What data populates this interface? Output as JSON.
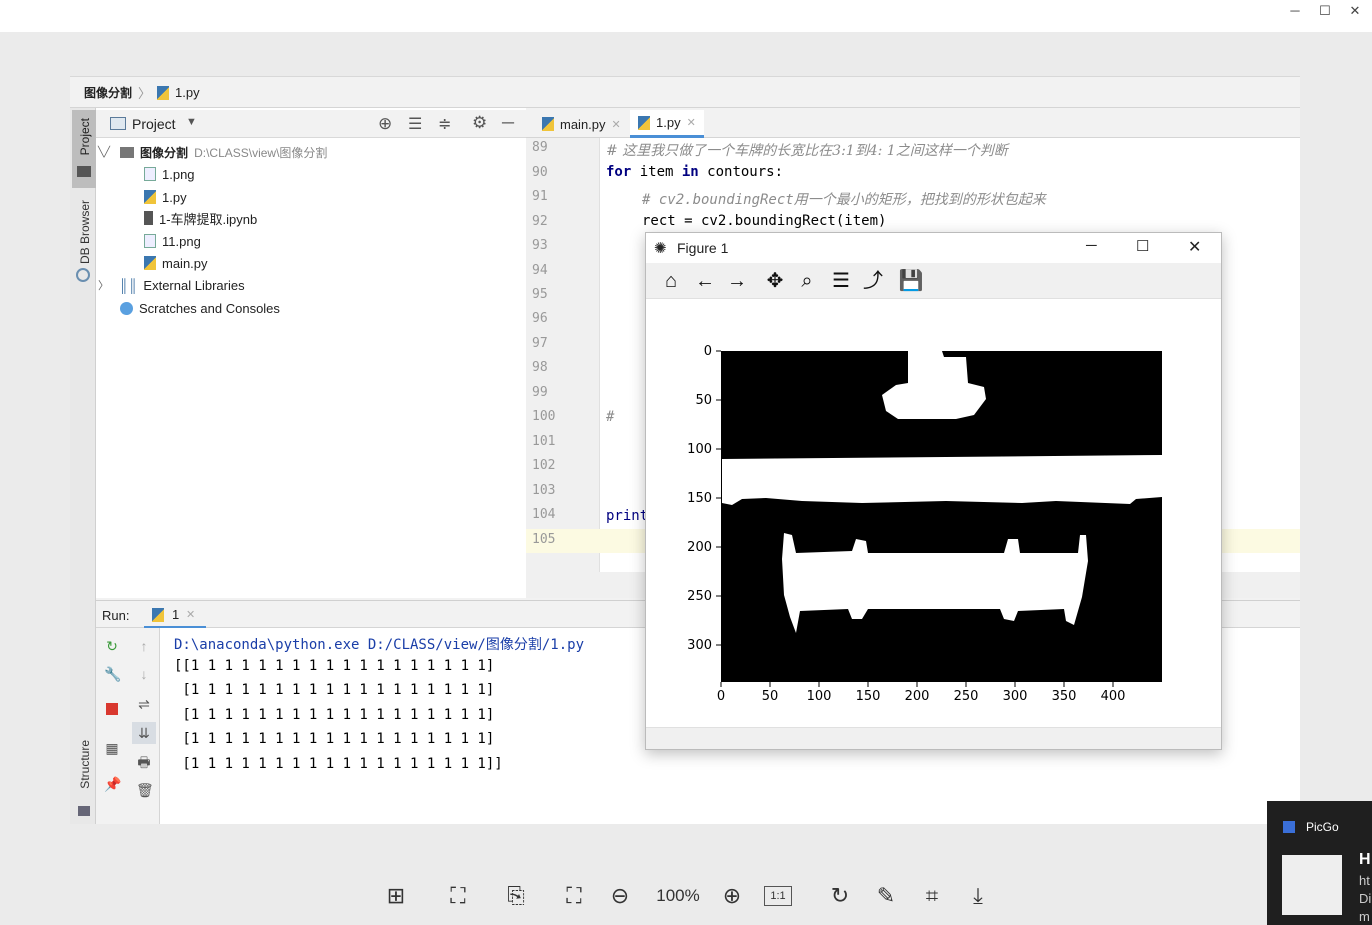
{
  "window": {
    "minimize": "─",
    "maximize": "☐",
    "close": "✕"
  },
  "breadcrumb": {
    "project": "图像分割",
    "file": "1.py"
  },
  "left_strip": {
    "project_tab": "Project",
    "db_tab": "DB Browser",
    "structure_tab": "Structure"
  },
  "project_panel": {
    "title": "Project",
    "root": {
      "name": "图像分割",
      "path": "D:\\CLASS\\view\\图像分割"
    },
    "files": [
      "1.png",
      "1.py",
      "1-车牌提取.ipynb",
      "11.png",
      "main.py"
    ],
    "external": "External Libraries",
    "scratches": "Scratches and Consoles"
  },
  "editor": {
    "tabs": [
      {
        "label": "main.py"
      },
      {
        "label": "1.py"
      }
    ],
    "line_numbers": [
      "89",
      "90",
      "91",
      "92",
      "93",
      "94",
      "95",
      "96",
      "97",
      "98",
      "99",
      "100",
      "101",
      "102",
      "103",
      "104",
      "105"
    ],
    "lines": {
      "l89": "# 这里我只做了一个车牌的长宽比在3:1到4: 1之间这样一个判断",
      "l90_kw1": "for",
      "l90_mid": " item ",
      "l90_kw2": "in",
      "l90_end": " contours:",
      "l91": "# cv2.boundingRect用一个最小的矩形，把找到的形状包起来",
      "l92": "rect = cv2.boundingRect(item)",
      "l100": "#",
      "l104": "print"
    }
  },
  "run": {
    "label": "Run:",
    "tab": "1",
    "command": "D:\\anaconda\\python.exe D:/CLASS/view/图像分割/1.py",
    "output": [
      "[[1 1 1 1 1 1 1 1 1 1 1 1 1 1 1 1 1 1]",
      " [1 1 1 1 1 1 1 1 1 1 1 1 1 1 1 1 1 1]",
      " [1 1 1 1 1 1 1 1 1 1 1 1 1 1 1 1 1 1]",
      " [1 1 1 1 1 1 1 1 1 1 1 1 1 1 1 1 1 1]",
      " [1 1 1 1 1 1 1 1 1 1 1 1 1 1 1 1 1 1]]"
    ]
  },
  "figure": {
    "title": "Figure 1",
    "toolbar_icons": [
      "home-icon",
      "back-arrow-icon",
      "forward-arrow-icon",
      "pan-icon",
      "zoom-icon",
      "subplots-icon",
      "edit-axis-icon",
      "save-icon"
    ],
    "x_ticks": [
      "0",
      "50",
      "100",
      "150",
      "200",
      "250",
      "300",
      "350",
      "400"
    ],
    "y_ticks": [
      "0",
      "50",
      "100",
      "150",
      "200",
      "250",
      "300"
    ]
  },
  "viewer_toolbar": {
    "zoom": "100%",
    "one_to_one": "1:1"
  },
  "picgo": {
    "app": "PicGo",
    "line1": "H",
    "line2": "ht",
    "line3": "Di",
    "line4": "m"
  }
}
